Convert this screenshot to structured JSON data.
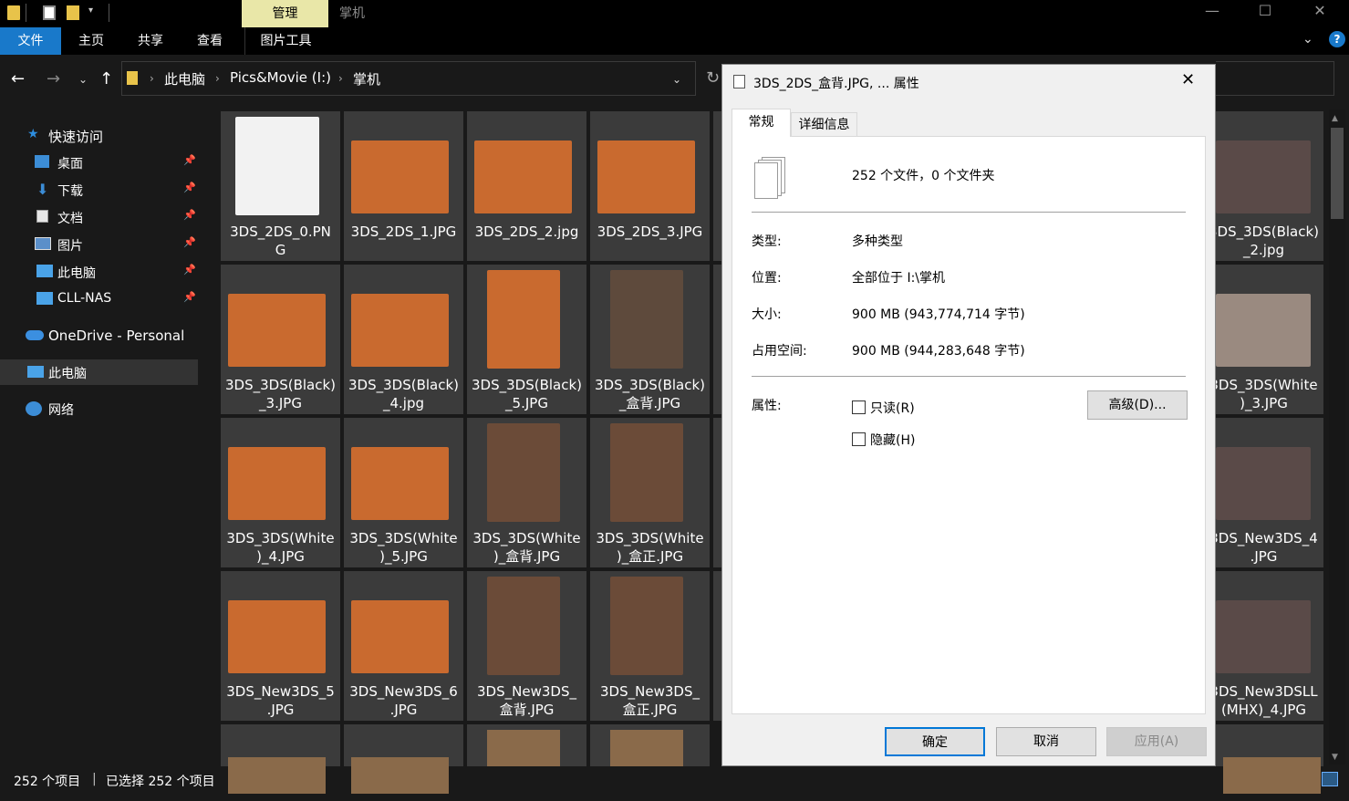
{
  "titlebar": {
    "context_tab": "管理",
    "title": "掌机",
    "minimize": "—",
    "maximize": "☐",
    "close": "✕"
  },
  "ribbon": {
    "tabs": [
      "文件",
      "主页",
      "共享",
      "查看",
      "图片工具"
    ]
  },
  "address": {
    "crumbs": [
      "此电脑",
      "Pics&Movie (I:)",
      "掌机"
    ]
  },
  "sidebar": {
    "quick_access": "快速访问",
    "items": [
      {
        "label": "桌面",
        "icon": "desktop-icon"
      },
      {
        "label": "下载",
        "icon": "download-icon"
      },
      {
        "label": "文档",
        "icon": "document-icon"
      },
      {
        "label": "图片",
        "icon": "pictures-icon"
      },
      {
        "label": "此电脑",
        "icon": "computer-icon"
      },
      {
        "label": "CLL-NAS",
        "icon": "network-drive-icon"
      }
    ],
    "onedrive": "OneDrive - Personal",
    "this_pc": "此电脑",
    "network": "网络"
  },
  "files": {
    "left_rows": [
      [
        "3DS_2DS_0.PN\nG",
        "3DS_2DS_1.JPG",
        "3DS_2DS_2.jpg",
        "3DS_2DS_3.JPG"
      ],
      [
        "3DS_3DS(Black)\n_3.JPG",
        "3DS_3DS(Black)\n_4.jpg",
        "3DS_3DS(Black)\n_5.JPG",
        "3DS_3DS(Black)\n_盒背.JPG"
      ],
      [
        "3DS_3DS(White\n)_4.JPG",
        "3DS_3DS(White\n)_5.JPG",
        "3DS_3DS(White\n)_盒背.JPG",
        "3DS_3DS(White\n)_盒正.JPG"
      ],
      [
        "3DS_New3DS_5\n.JPG",
        "3DS_New3DS_6\n.JPG",
        "3DS_New3DS_\n盒背.JPG",
        "3DS_New3DS_\n盒正.JPG"
      ]
    ],
    "right_col": [
      "3DS_3DS(Black)\n_2.jpg",
      "3DS_3DS(White\n)_3.JPG",
      "3DS_New3DS_4\n.JPG",
      "3DS_New3DSLL\n(MHX)_4.JPG"
    ]
  },
  "status": {
    "count": "252 个项目",
    "selected": "已选择 252 个项目"
  },
  "dialog": {
    "title": "3DS_2DS_盒背.JPG, ... 属性",
    "tabs": [
      "常规",
      "详细信息"
    ],
    "summary": "252 个文件，0 个文件夹",
    "rows": [
      {
        "label": "类型:",
        "value": "多种类型"
      },
      {
        "label": "位置:",
        "value": "全部位于 I:\\掌机"
      },
      {
        "label": "大小:",
        "value": "900 MB (943,774,714 字节)"
      },
      {
        "label": "占用空间:",
        "value": "900 MB (944,283,648 字节)"
      }
    ],
    "attributes_label": "属性:",
    "readonly": "只读(R)",
    "hidden": "隐藏(H)",
    "advanced": "高级(D)...",
    "ok": "确定",
    "cancel": "取消",
    "apply": "应用(A)"
  },
  "colors": {
    "accent": "#1979ca",
    "manage_tab": "#e9e7a8",
    "tile": "#3b3b3b"
  }
}
